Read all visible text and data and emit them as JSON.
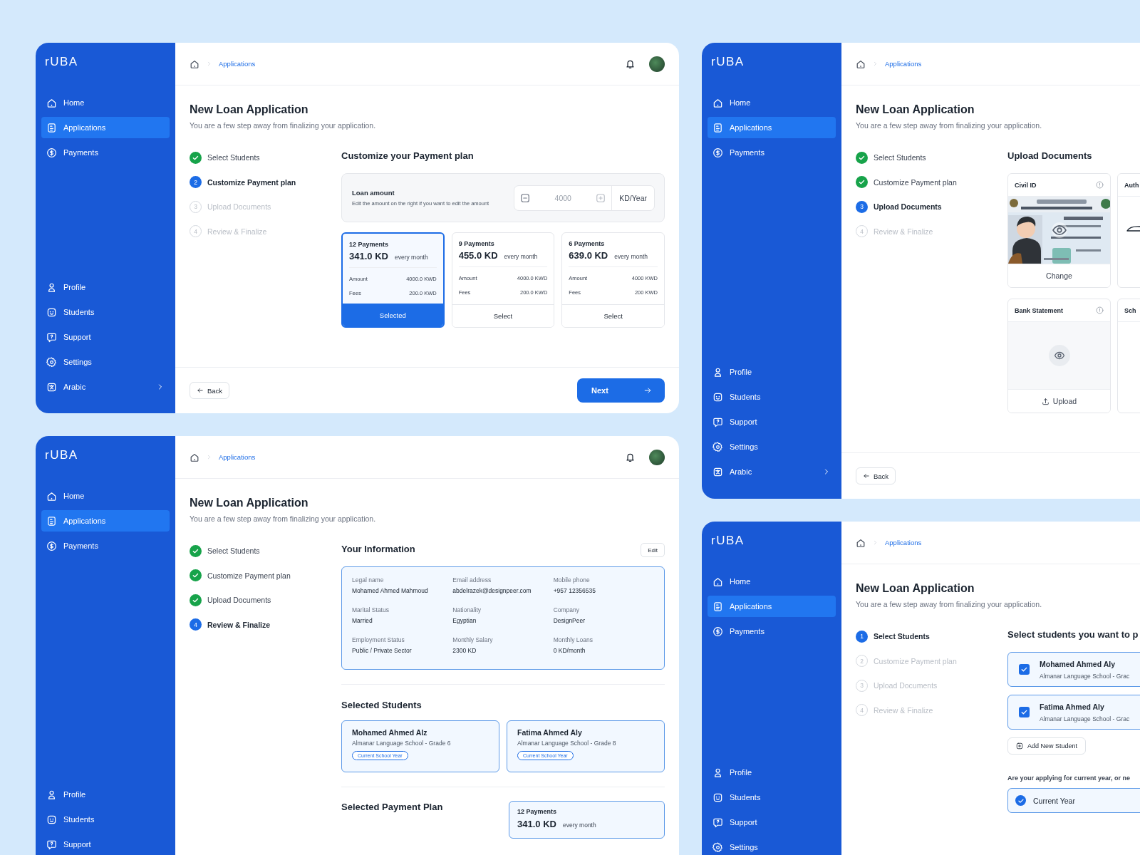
{
  "screens": [
    {
      "kind": "payment_plan",
      "sidebar": {
        "logo": "rUBA",
        "items": [
          {
            "label": "Home",
            "selected": false,
            "submenu": false
          },
          {
            "label": "Applications",
            "selected": true,
            "submenu": false
          },
          {
            "label": "Payments",
            "selected": false,
            "submenu": false
          }
        ],
        "bottom_items": [
          {
            "label": "Profile",
            "selected": false,
            "submenu": false
          },
          {
            "label": "Students",
            "selected": false,
            "submenu": false
          },
          {
            "label": "Support",
            "selected": false,
            "submenu": false
          },
          {
            "label": "Settings",
            "selected": false,
            "submenu": false
          },
          {
            "label": "Arabic",
            "selected": false,
            "submenu": true
          }
        ]
      },
      "breadcrumb": "Applications",
      "notifications": true,
      "avatar": true,
      "title": "New Loan Application",
      "subtitle": "You are a few step away from finalizing your application.",
      "steps": [
        {
          "label": "Select Students",
          "completed": true,
          "active": false
        },
        {
          "number": "2",
          "label": "Customize Payment plan",
          "completed": false,
          "active": true
        },
        {
          "number": "3",
          "label": "Upload Documents",
          "completed": false,
          "active": false
        },
        {
          "number": "4",
          "label": "Review & Finalize",
          "completed": false,
          "active": false
        }
      ],
      "section_title": "Customize your Payment plan",
      "loan_amount": {
        "title": "Loan amount",
        "description": "Edit the amount on the right if you want to edit the amount",
        "value": "4000",
        "unit": "KD/Year"
      },
      "plans": [
        {
          "title": "12 Payments",
          "amount": "341.0 KD",
          "period": "every month",
          "rows": [
            {
              "label": "Amount",
              "value": "4000.0 KWD"
            },
            {
              "label": "Fees",
              "value": "200.0 KWD"
            }
          ],
          "button": "Selected",
          "selected": true
        },
        {
          "title": "9 Payments",
          "amount": "455.0 KD",
          "period": "every month",
          "rows": [
            {
              "label": "Amount",
              "value": "4000.0 KWD"
            },
            {
              "label": "Fees",
              "value": "200.0 KWD"
            }
          ],
          "button": "Select",
          "selected": false
        },
        {
          "title": "6 Payments",
          "amount": "639.0 KD",
          "period": "every month",
          "rows": [
            {
              "label": "Amount",
              "value": "4000 KWD"
            },
            {
              "label": "Fees",
              "value": "200 KWD"
            }
          ],
          "button": "Select",
          "selected": false
        }
      ],
      "footer": {
        "back": "Back",
        "next": "Next"
      }
    },
    {
      "kind": "upload",
      "sidebar": {
        "logo": "rUBA",
        "items": [
          {
            "label": "Home",
            "selected": false,
            "submenu": false
          },
          {
            "label": "Applications",
            "selected": true,
            "submenu": false
          },
          {
            "label": "Payments",
            "selected": false,
            "submenu": false
          }
        ],
        "bottom_items": [
          {
            "label": "Profile",
            "selected": false,
            "submenu": false
          },
          {
            "label": "Students",
            "selected": false,
            "submenu": false
          },
          {
            "label": "Support",
            "selected": false,
            "submenu": false
          },
          {
            "label": "Settings",
            "selected": false,
            "submenu": false
          },
          {
            "label": "Arabic",
            "selected": false,
            "submenu": true
          }
        ]
      },
      "breadcrumb": "Applications",
      "title": "New Loan Application",
      "subtitle": "You are a few step away from finalizing your application.",
      "steps": [
        {
          "label": "Select Students",
          "completed": true,
          "active": false
        },
        {
          "label": "Customize Payment plan",
          "completed": true,
          "active": false
        },
        {
          "number": "3",
          "label": "Upload Documents",
          "completed": false,
          "active": true
        },
        {
          "number": "4",
          "label": "Review & Finalize",
          "completed": false,
          "active": false
        }
      ],
      "section_title": "Upload Documents",
      "documents": [
        {
          "title": "Civil ID",
          "kind": "picture",
          "info": true,
          "action": "Change"
        },
        {
          "title": "Auth",
          "kind": "signature"
        },
        {
          "title": "Bank Statement",
          "kind": "empty",
          "info": true,
          "action": "Upload"
        },
        {
          "title": "Sch",
          "kind": "blank"
        }
      ],
      "footer": {
        "back": "Back"
      }
    },
    {
      "kind": "review",
      "sidebar": {
        "logo": "rUBA",
        "items": [
          {
            "label": "Home",
            "selected": false,
            "submenu": false
          },
          {
            "label": "Applications",
            "selected": true,
            "submenu": false
          },
          {
            "label": "Payments",
            "selected": false,
            "submenu": false
          }
        ],
        "bottom_items": [
          {
            "label": "Profile",
            "selected": false,
            "submenu": false
          },
          {
            "label": "Students",
            "selected": false,
            "submenu": false
          },
          {
            "label": "Support",
            "selected": false,
            "submenu": false
          }
        ]
      },
      "breadcrumb": "Applications",
      "notifications": true,
      "avatar": true,
      "title": "New Loan Application",
      "subtitle": "You are a few step away from finalizing your application.",
      "steps": [
        {
          "label": "Select Students",
          "completed": true,
          "active": false
        },
        {
          "label": "Customize Payment plan",
          "completed": true,
          "active": false
        },
        {
          "label": "Upload Documents",
          "completed": true,
          "active": false
        },
        {
          "number": "4",
          "label": "Review & Finalize",
          "completed": false,
          "active": true
        }
      ],
      "info": {
        "title": "Your Information",
        "edit": "Edit",
        "fields": [
          {
            "label": "Legal name",
            "value": "Mohamed Ahmed Mahmoud"
          },
          {
            "label": "Email address",
            "value": "abdelrazek@designpeer.com"
          },
          {
            "label": "Mobile phone",
            "value": "+957 12356535"
          },
          {
            "label": "Marital Status",
            "value": "Married"
          },
          {
            "label": "Nationality",
            "value": "Egyptian"
          },
          {
            "label": "Company",
            "value": "DesignPeer"
          },
          {
            "label": "Employment Status",
            "value": "Public / Private Sector"
          },
          {
            "label": "Monthly Salary",
            "value": "2300 KD"
          },
          {
            "label": "Monthly Loans",
            "value": "0 KD/month"
          }
        ]
      },
      "selected_students": {
        "title": "Selected Students",
        "items": [
          {
            "name": "Mohamed Ahmed Alz",
            "school": "Almanar Language School - Grade 6",
            "tag": "Current School Year"
          },
          {
            "name": "Fatima Ahmed Aly",
            "school": "Almanar Language School - Grade 8",
            "tag": "Current School Year"
          }
        ]
      },
      "selected_plan": {
        "title": "Selected Payment Plan",
        "plan_title": "12 Payments",
        "amount": "341.0 KD",
        "period": "every month"
      }
    },
    {
      "kind": "select_students",
      "sidebar": {
        "logo": "rUBA",
        "items": [
          {
            "label": "Home",
            "selected": false,
            "submenu": false
          },
          {
            "label": "Applications",
            "selected": true,
            "submenu": false
          },
          {
            "label": "Payments",
            "selected": false,
            "submenu": false
          }
        ],
        "bottom_items": [
          {
            "label": "Profile",
            "selected": false,
            "submenu": false
          },
          {
            "label": "Students",
            "selected": false,
            "submenu": false
          },
          {
            "label": "Support",
            "selected": false,
            "submenu": false
          },
          {
            "label": "Settings",
            "selected": false,
            "submenu": false
          }
        ]
      },
      "breadcrumb": "Applications",
      "title": "New Loan Application",
      "subtitle": "You are a few step away from finalizing your application.",
      "steps": [
        {
          "number": "1",
          "label": "Select Students",
          "completed": false,
          "active": true
        },
        {
          "number": "2",
          "label": "Customize Payment plan",
          "completed": false,
          "active": false
        },
        {
          "number": "3",
          "label": "Upload Documents",
          "completed": false,
          "active": false
        },
        {
          "number": "4",
          "label": "Review & Finalize",
          "completed": false,
          "active": false
        }
      ],
      "section_title": "Select students you want to p",
      "students": [
        {
          "name": "Mohamed Ahmed Aly",
          "school": "Almanar Language School - Grac",
          "checked": true
        },
        {
          "name": "Fatima Ahmed Aly",
          "school": "Almanar Language School - Grac",
          "checked": true
        }
      ],
      "add_button": "Add New Student",
      "question": "Are your applying for current year, or ne",
      "options": [
        {
          "label": "Current Year",
          "selected": true
        }
      ]
    }
  ]
}
